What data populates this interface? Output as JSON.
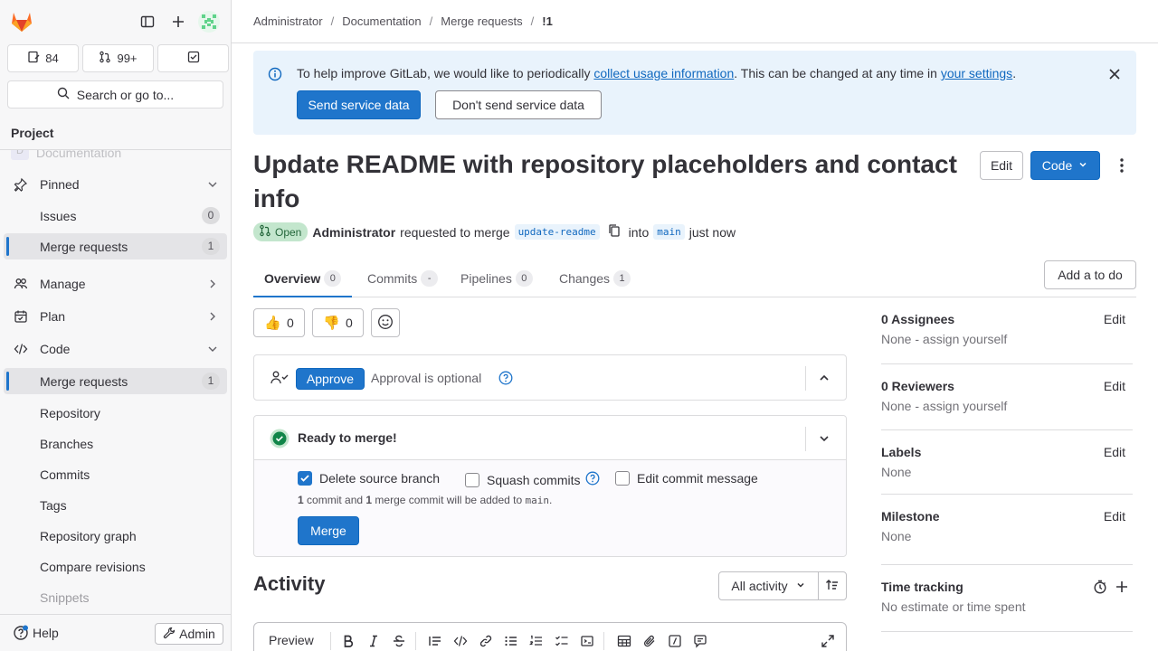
{
  "sidebar": {
    "counts": {
      "issues": "84",
      "merge_requests": "99+"
    },
    "search_label": "Search or go to...",
    "context_label": "Project",
    "ghost_project": {
      "avatar": "D",
      "name": "Documentation"
    },
    "items": [
      {
        "label": "Pinned",
        "kind": "section"
      },
      {
        "label": "Issues",
        "badge": "0"
      },
      {
        "label": "Merge requests",
        "badge": "1"
      },
      {
        "label": "Manage",
        "kind": "section"
      },
      {
        "label": "Plan",
        "kind": "section"
      },
      {
        "label": "Code",
        "kind": "section"
      },
      {
        "label": "Merge requests",
        "badge": "1"
      },
      {
        "label": "Repository"
      },
      {
        "label": "Branches"
      },
      {
        "label": "Commits"
      },
      {
        "label": "Tags"
      },
      {
        "label": "Repository graph"
      },
      {
        "label": "Compare revisions"
      },
      {
        "label": "Snippets"
      }
    ],
    "help_label": "Help",
    "admin_label": "Admin"
  },
  "breadcrumb": [
    "Administrator",
    "Documentation",
    "Merge requests",
    "!1"
  ],
  "alert": {
    "text_before": "To help improve GitLab, we would like to periodically ",
    "link1": "collect usage information",
    "text_mid": ". This can be changed at any time in ",
    "link2": "your settings",
    "text_after": ".",
    "send_label": "Send service data",
    "dont_send_label": "Don't send service data"
  },
  "mr": {
    "title": "Update README with repository placeholders and contact info",
    "edit_label": "Edit",
    "code_label": "Code",
    "status": "Open",
    "author": "Administrator",
    "requested_text": "requested to merge",
    "source_branch": "update-readme",
    "into_text": "into",
    "target_branch": "main",
    "time": "just now"
  },
  "tabs": [
    {
      "label": "Overview",
      "count": "0"
    },
    {
      "label": "Commits",
      "count": "-"
    },
    {
      "label": "Pipelines",
      "count": "0"
    },
    {
      "label": "Changes",
      "count": "1"
    }
  ],
  "add_todo_label": "Add a to do",
  "reactions": {
    "thumbs_up": "0",
    "thumbs_down": "0"
  },
  "approval": {
    "approve_label": "Approve",
    "optional_text": "Approval is optional"
  },
  "merge": {
    "ready_text": "Ready to merge!",
    "delete_source": "Delete source branch",
    "squash": "Squash commits",
    "edit_message": "Edit commit message",
    "info_num1": "1",
    "info_text1": " commit and ",
    "info_num2": "1",
    "info_text2": " merge commit will be added to ",
    "info_branch": "main",
    "info_end": ".",
    "merge_label": "Merge"
  },
  "activity": {
    "title": "Activity",
    "filter_label": "All activity"
  },
  "editor": {
    "preview_label": "Preview"
  },
  "right_sidebar": {
    "assignees": {
      "title": "0 Assignees",
      "value": "None - assign yourself",
      "edit": "Edit"
    },
    "reviewers": {
      "title": "0 Reviewers",
      "value": "None - assign yourself",
      "edit": "Edit"
    },
    "labels": {
      "title": "Labels",
      "value": "None",
      "edit": "Edit"
    },
    "milestone": {
      "title": "Milestone",
      "value": "None",
      "edit": "Edit"
    },
    "time_tracking": {
      "title": "Time tracking",
      "value": "No estimate or time spent"
    }
  },
  "colors": {
    "accent": "#1f75cb",
    "success": "#108548",
    "alert_bg": "#e9f3fc"
  }
}
